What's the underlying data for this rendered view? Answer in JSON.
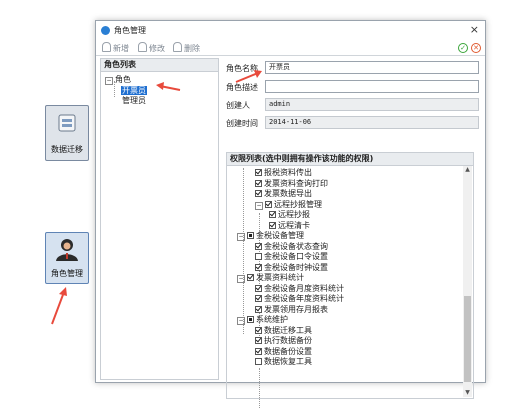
{
  "desktop": {
    "migrate_label": "数据迁移",
    "role_label": "角色管理"
  },
  "window": {
    "title": "角色管理",
    "close": "×"
  },
  "toolbar": {
    "add_label": "新增",
    "edit_label": "修改",
    "delete_label": "删除"
  },
  "role_list": {
    "header": "角色列表",
    "root": "角色",
    "items": [
      "开票员",
      "管理员"
    ]
  },
  "form": {
    "name_label": "角色名称",
    "name_value": "开票员",
    "desc_label": "角色描述",
    "desc_value": "",
    "creator_label": "创建人",
    "creator_value": "admin",
    "time_label": "创建时间",
    "time_value": "2014-11-06"
  },
  "permissions": {
    "header": "权限列表(选中则拥有操作该功能的权限)",
    "rows": [
      "报税资料传出",
      "发票资料查询打印",
      "发票数据导出",
      "远程抄报管理",
      "远程抄报",
      "远程清卡",
      "金税设备管理",
      "金税设备状态查询",
      "金税设备口令设置",
      "金税设备时钟设置",
      "发票资料统计",
      "金税设备月度资料统计",
      "金税设备年度资料统计",
      "发票领用存月报表",
      "系统维护",
      "数据迁移工具",
      "执行数据备份",
      "数据备份设置",
      "数据恢复工具"
    ],
    "checked": [
      true,
      true,
      true,
      true,
      true,
      true,
      false,
      true,
      false,
      true,
      true,
      true,
      true,
      true,
      false,
      true,
      true,
      true,
      false
    ]
  },
  "colors": {
    "selection": "#1f6fd0",
    "annotation_arrow": "#e84a3c"
  }
}
